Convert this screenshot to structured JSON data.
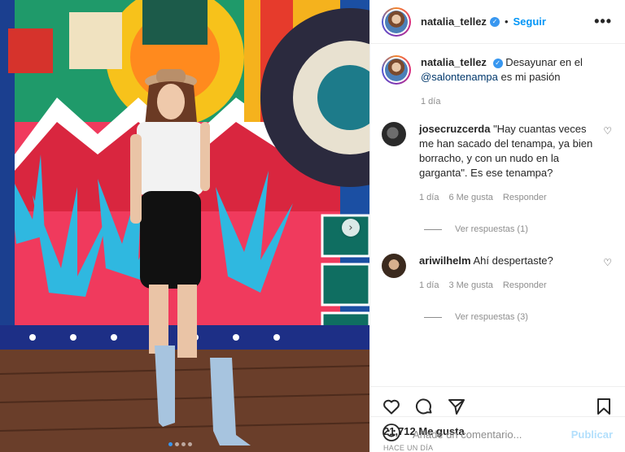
{
  "post": {
    "author": {
      "username": "natalia_tellez",
      "verified": true
    },
    "header": {
      "separator": "•",
      "follow_label": "Seguir",
      "more_label": "•••"
    },
    "caption": {
      "username": "natalia_tellez",
      "text_before": "Desayunar en el",
      "mention": "@salontenampa",
      "text_after": "es mi pasión",
      "time": "1 día"
    },
    "comments": [
      {
        "username": "josecruzcerda",
        "text": "\"Hay cuantas veces me han sacado del tenampa, ya bien borracho, y con un nudo en la garganta\". Es ese tenampa?",
        "time": "1 día",
        "likes": "6 Me gusta",
        "reply_label": "Responder",
        "view_replies": "Ver respuestas (1)"
      },
      {
        "username": "ariwilhelm",
        "text": "Ahí despertaste?",
        "time": "1 día",
        "likes": "3 Me gusta",
        "reply_label": "Responder",
        "view_replies": "Ver respuestas (3)"
      }
    ],
    "likes_count": "21,712 Me gusta",
    "date": "HACE UN DÍA",
    "add_comment": {
      "placeholder": "Añade un comentario...",
      "publish_label": "Publicar"
    },
    "carousel": {
      "next_label": "›",
      "total": 4,
      "current": 1
    }
  },
  "icons": {
    "verified": "verified-badge-icon",
    "like": "heart-icon",
    "comment": "comment-icon",
    "share": "paper-plane-icon",
    "save": "bookmark-icon",
    "emoji": "smiley-icon",
    "more": "more-options-icon"
  },
  "colors": {
    "link_blue": "#0095f6",
    "mention": "#00376b",
    "muted": "#8e8e8e",
    "publish_disabled": "#b2dffc",
    "verified": "#3897f0"
  }
}
